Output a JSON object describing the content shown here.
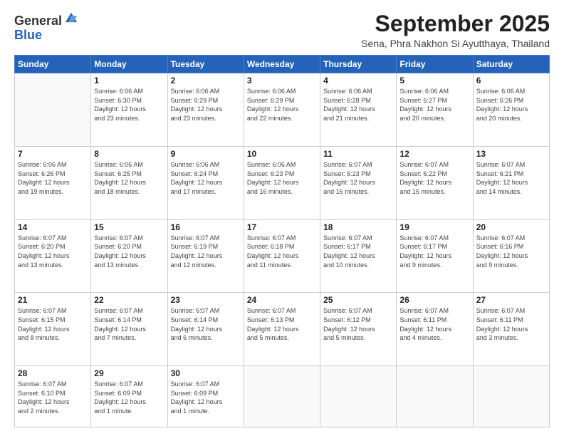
{
  "header": {
    "logo_line1": "General",
    "logo_line2": "Blue",
    "month": "September 2025",
    "location": "Sena, Phra Nakhon Si Ayutthaya, Thailand"
  },
  "days_of_week": [
    "Sunday",
    "Monday",
    "Tuesday",
    "Wednesday",
    "Thursday",
    "Friday",
    "Saturday"
  ],
  "weeks": [
    [
      {
        "day": "",
        "info": ""
      },
      {
        "day": "1",
        "info": "Sunrise: 6:06 AM\nSunset: 6:30 PM\nDaylight: 12 hours\nand 23 minutes."
      },
      {
        "day": "2",
        "info": "Sunrise: 6:06 AM\nSunset: 6:29 PM\nDaylight: 12 hours\nand 23 minutes."
      },
      {
        "day": "3",
        "info": "Sunrise: 6:06 AM\nSunset: 6:29 PM\nDaylight: 12 hours\nand 22 minutes."
      },
      {
        "day": "4",
        "info": "Sunrise: 6:06 AM\nSunset: 6:28 PM\nDaylight: 12 hours\nand 21 minutes."
      },
      {
        "day": "5",
        "info": "Sunrise: 6:06 AM\nSunset: 6:27 PM\nDaylight: 12 hours\nand 20 minutes."
      },
      {
        "day": "6",
        "info": "Sunrise: 6:06 AM\nSunset: 6:26 PM\nDaylight: 12 hours\nand 20 minutes."
      }
    ],
    [
      {
        "day": "7",
        "info": "Sunrise: 6:06 AM\nSunset: 6:26 PM\nDaylight: 12 hours\nand 19 minutes."
      },
      {
        "day": "8",
        "info": "Sunrise: 6:06 AM\nSunset: 6:25 PM\nDaylight: 12 hours\nand 18 minutes."
      },
      {
        "day": "9",
        "info": "Sunrise: 6:06 AM\nSunset: 6:24 PM\nDaylight: 12 hours\nand 17 minutes."
      },
      {
        "day": "10",
        "info": "Sunrise: 6:06 AM\nSunset: 6:23 PM\nDaylight: 12 hours\nand 16 minutes."
      },
      {
        "day": "11",
        "info": "Sunrise: 6:07 AM\nSunset: 6:23 PM\nDaylight: 12 hours\nand 16 minutes."
      },
      {
        "day": "12",
        "info": "Sunrise: 6:07 AM\nSunset: 6:22 PM\nDaylight: 12 hours\nand 15 minutes."
      },
      {
        "day": "13",
        "info": "Sunrise: 6:07 AM\nSunset: 6:21 PM\nDaylight: 12 hours\nand 14 minutes."
      }
    ],
    [
      {
        "day": "14",
        "info": "Sunrise: 6:07 AM\nSunset: 6:20 PM\nDaylight: 12 hours\nand 13 minutes."
      },
      {
        "day": "15",
        "info": "Sunrise: 6:07 AM\nSunset: 6:20 PM\nDaylight: 12 hours\nand 13 minutes."
      },
      {
        "day": "16",
        "info": "Sunrise: 6:07 AM\nSunset: 6:19 PM\nDaylight: 12 hours\nand 12 minutes."
      },
      {
        "day": "17",
        "info": "Sunrise: 6:07 AM\nSunset: 6:18 PM\nDaylight: 12 hours\nand 11 minutes."
      },
      {
        "day": "18",
        "info": "Sunrise: 6:07 AM\nSunset: 6:17 PM\nDaylight: 12 hours\nand 10 minutes."
      },
      {
        "day": "19",
        "info": "Sunrise: 6:07 AM\nSunset: 6:17 PM\nDaylight: 12 hours\nand 9 minutes."
      },
      {
        "day": "20",
        "info": "Sunrise: 6:07 AM\nSunset: 6:16 PM\nDaylight: 12 hours\nand 9 minutes."
      }
    ],
    [
      {
        "day": "21",
        "info": "Sunrise: 6:07 AM\nSunset: 6:15 PM\nDaylight: 12 hours\nand 8 minutes."
      },
      {
        "day": "22",
        "info": "Sunrise: 6:07 AM\nSunset: 6:14 PM\nDaylight: 12 hours\nand 7 minutes."
      },
      {
        "day": "23",
        "info": "Sunrise: 6:07 AM\nSunset: 6:14 PM\nDaylight: 12 hours\nand 6 minutes."
      },
      {
        "day": "24",
        "info": "Sunrise: 6:07 AM\nSunset: 6:13 PM\nDaylight: 12 hours\nand 5 minutes."
      },
      {
        "day": "25",
        "info": "Sunrise: 6:07 AM\nSunset: 6:12 PM\nDaylight: 12 hours\nand 5 minutes."
      },
      {
        "day": "26",
        "info": "Sunrise: 6:07 AM\nSunset: 6:11 PM\nDaylight: 12 hours\nand 4 minutes."
      },
      {
        "day": "27",
        "info": "Sunrise: 6:07 AM\nSunset: 6:11 PM\nDaylight: 12 hours\nand 3 minutes."
      }
    ],
    [
      {
        "day": "28",
        "info": "Sunrise: 6:07 AM\nSunset: 6:10 PM\nDaylight: 12 hours\nand 2 minutes."
      },
      {
        "day": "29",
        "info": "Sunrise: 6:07 AM\nSunset: 6:09 PM\nDaylight: 12 hours\nand 1 minute."
      },
      {
        "day": "30",
        "info": "Sunrise: 6:07 AM\nSunset: 6:09 PM\nDaylight: 12 hours\nand 1 minute."
      },
      {
        "day": "",
        "info": ""
      },
      {
        "day": "",
        "info": ""
      },
      {
        "day": "",
        "info": ""
      },
      {
        "day": "",
        "info": ""
      }
    ]
  ]
}
